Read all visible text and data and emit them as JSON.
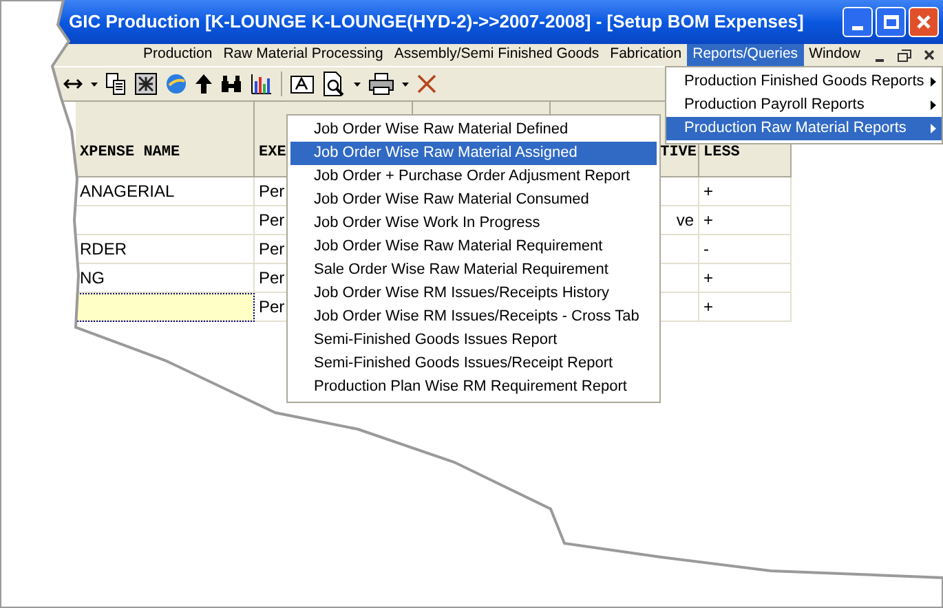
{
  "window": {
    "title": "GIC Production  [K-LOUNGE K-LOUNGE(HYD-2)->>2007-2008] - [Setup BOM Expenses]"
  },
  "menu_bar": [
    {
      "label": "Production",
      "selected": false
    },
    {
      "label": "Raw Material Processing",
      "selected": false
    },
    {
      "label": "Assembly/Semi Finished Goods",
      "selected": false
    },
    {
      "label": "Fabrication",
      "selected": false
    },
    {
      "label": "Reports/Queries",
      "selected": true
    },
    {
      "label": "Window",
      "selected": false
    }
  ],
  "submenu": [
    {
      "label": "Production Finished Goods Reports",
      "selected": false,
      "has_submenu": true
    },
    {
      "label": "Production Payroll Reports",
      "selected": false,
      "has_submenu": true
    },
    {
      "label": "Production Raw Material Reports",
      "selected": true,
      "has_submenu": true
    }
  ],
  "dropdown": [
    {
      "label": "Job Order Wise Raw Material Defined",
      "selected": false
    },
    {
      "label": "Job Order Wise Raw Material Assigned",
      "selected": true
    },
    {
      "label": "Job Order + Purchase Order Adjusment Report",
      "selected": false
    },
    {
      "label": "Job Order Wise Raw Material Consumed",
      "selected": false
    },
    {
      "label": "Job Order Wise Work In Progress",
      "selected": false
    },
    {
      "label": "Job Order Wise Raw Material Requirement",
      "selected": false
    },
    {
      "label": "Sale Order Wise Raw Material Requirement",
      "selected": false
    },
    {
      "label": "Job Order Wise RM Issues/Receipts History",
      "selected": false
    },
    {
      "label": "Job Order Wise RM Issues/Receipts - Cross Tab",
      "selected": false
    },
    {
      "label": "Semi-Finished Goods Issues Report",
      "selected": false
    },
    {
      "label": "Semi-Finished Goods Issues/Receipt Report",
      "selected": false
    },
    {
      "label": "Production Plan Wise RM Requirement Report",
      "selected": false
    }
  ],
  "table": {
    "columns": {
      "column_1": "XPENSE NAME",
      "column_2": "EXE",
      "column_5": "TIVE",
      "column_6": "LESS"
    },
    "rows": [
      {
        "column_1": "ANAGERIAL",
        "column_2": "Per",
        "column_6": "+",
        "editing": false
      },
      {
        "column_2": "Per",
        "column_5": "ve",
        "column_6": "+",
        "editing": false
      },
      {
        "column_1": "RDER",
        "column_2": "Per",
        "column_6": "-",
        "editing": false
      },
      {
        "column_1": "NG",
        "column_2": "Per",
        "column_6": "+",
        "editing": false
      },
      {
        "column_2": "Per",
        "column_6": "+",
        "editing": true
      }
    ]
  }
}
